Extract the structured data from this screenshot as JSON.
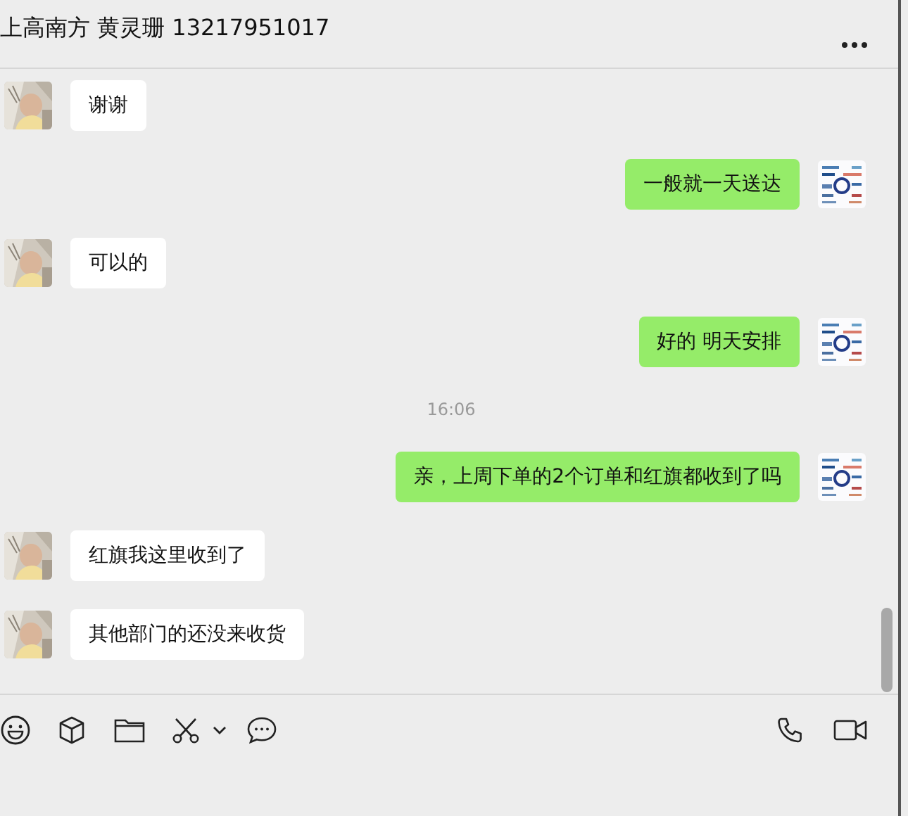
{
  "header": {
    "title": "上高南方 黄灵珊 13217951017"
  },
  "messages": [
    {
      "kind": "received",
      "text": "谢谢"
    },
    {
      "kind": "sent",
      "text": "一般就一天送达"
    },
    {
      "kind": "received",
      "text": "可以的"
    },
    {
      "kind": "sent",
      "text": "好的 明天安排"
    },
    {
      "kind": "time",
      "text": "16:06"
    },
    {
      "kind": "sent",
      "text": "亲，上周下单的2个订单和红旗都收到了吗"
    },
    {
      "kind": "received",
      "text": "红旗我这里收到了"
    },
    {
      "kind": "received",
      "text": "其他部门的还没来收货"
    }
  ]
}
